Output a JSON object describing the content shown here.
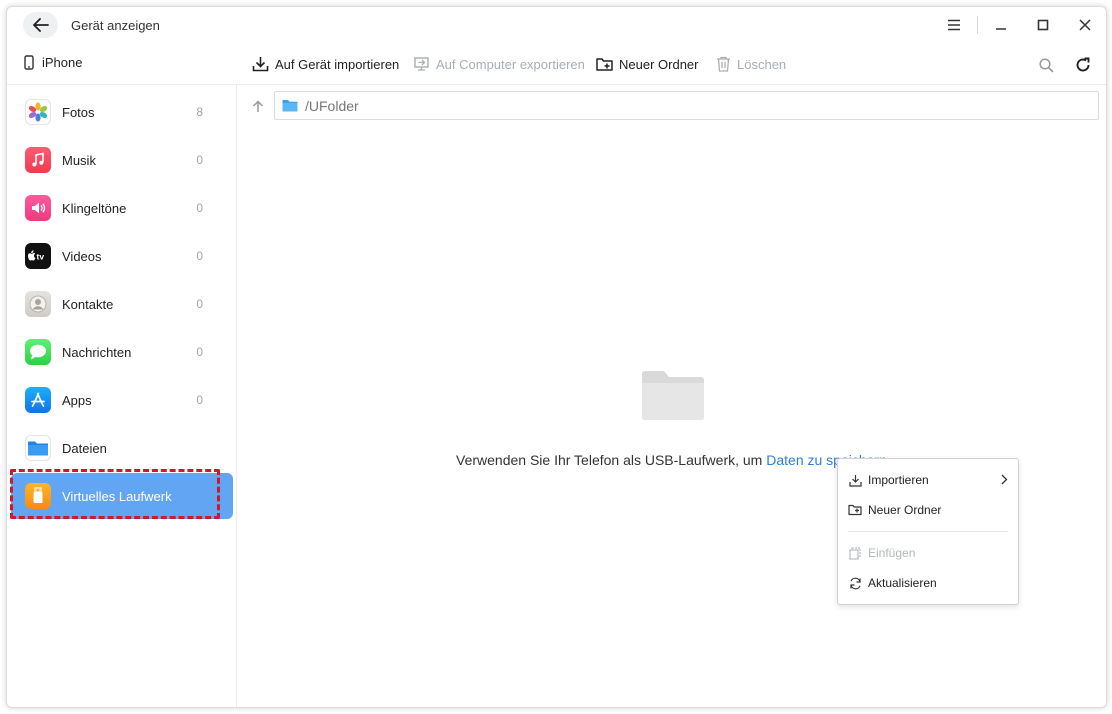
{
  "window": {
    "title": "Gerät anzeigen"
  },
  "device": {
    "name": "iPhone"
  },
  "toolbar": {
    "import_label": "Auf Gerät importieren",
    "export_label": "Auf Computer exportieren",
    "new_folder_label": "Neuer Ordner",
    "delete_label": "Löschen"
  },
  "sidebar": {
    "items": [
      {
        "label": "Fotos",
        "count": "8",
        "icon": "photos-icon"
      },
      {
        "label": "Musik",
        "count": "0",
        "icon": "music-icon"
      },
      {
        "label": "Klingeltöne",
        "count": "0",
        "icon": "ringtone-icon"
      },
      {
        "label": "Videos",
        "count": "0",
        "icon": "tv-icon"
      },
      {
        "label": "Kontakte",
        "count": "0",
        "icon": "contacts-icon"
      },
      {
        "label": "Nachrichten",
        "count": "0",
        "icon": "messages-icon"
      },
      {
        "label": "Apps",
        "count": "0",
        "icon": "appstore-icon"
      },
      {
        "label": "Dateien",
        "count": "",
        "icon": "files-icon"
      },
      {
        "label": "Virtuelles Laufwerk",
        "count": "",
        "icon": "usb-drive-icon",
        "active": true
      }
    ]
  },
  "main": {
    "path": "/UFolder",
    "empty_message": "Verwenden Sie Ihr Telefon als USB-Laufwerk, um ",
    "empty_link": "Daten zu speichern"
  },
  "context_menu": {
    "items": [
      {
        "label": "Importieren",
        "icon": "import-icon",
        "submenu": true,
        "enabled": true
      },
      {
        "label": "Neuer Ordner",
        "icon": "new-folder-icon",
        "enabled": true
      },
      {
        "label": "Einfügen",
        "icon": "paste-icon",
        "enabled": false
      },
      {
        "label": "Aktualisieren",
        "icon": "refresh-icon",
        "enabled": true
      }
    ]
  },
  "colors": {
    "accent": "#62a6f3",
    "link": "#2f7fd3",
    "highlight_border": "#d3172a"
  }
}
